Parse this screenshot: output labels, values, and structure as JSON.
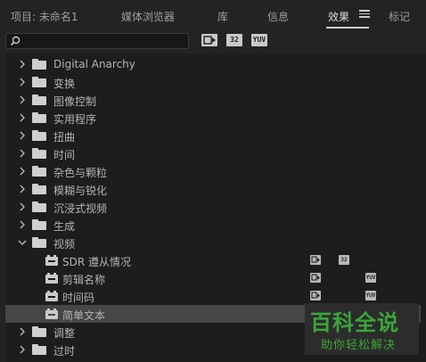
{
  "tabs": [
    {
      "label": "项目: 未命名1",
      "active": false
    },
    {
      "label": "媒体浏览器",
      "active": false
    },
    {
      "label": "库",
      "active": false
    },
    {
      "label": "信息",
      "active": false
    },
    {
      "label": "效果",
      "active": true
    },
    {
      "label": "标记",
      "active": false
    }
  ],
  "toolbar": {
    "search_value": "",
    "badges": [
      "accelerated",
      "32",
      "YUV"
    ]
  },
  "tree": [
    {
      "label": "Digital Anarchy",
      "type": "folder",
      "expanded": false
    },
    {
      "label": "变换",
      "type": "folder",
      "expanded": false
    },
    {
      "label": "图像控制",
      "type": "folder",
      "expanded": false
    },
    {
      "label": "实用程序",
      "type": "folder",
      "expanded": false
    },
    {
      "label": "扭曲",
      "type": "folder",
      "expanded": false
    },
    {
      "label": "时间",
      "type": "folder",
      "expanded": false
    },
    {
      "label": "杂色与颗粒",
      "type": "folder",
      "expanded": false
    },
    {
      "label": "模糊与锐化",
      "type": "folder",
      "expanded": false
    },
    {
      "label": "沉浸式视频",
      "type": "folder",
      "expanded": false
    },
    {
      "label": "生成",
      "type": "folder",
      "expanded": false
    },
    {
      "label": "视频",
      "type": "folder",
      "expanded": true
    },
    {
      "label": "SDR 遵从情况",
      "type": "effect",
      "badges": [
        "accelerated",
        "32"
      ]
    },
    {
      "label": "剪辑名称",
      "type": "effect",
      "badges": [
        "accelerated",
        "YUV"
      ]
    },
    {
      "label": "时间码",
      "type": "effect",
      "badges": [
        "accelerated",
        "YUV"
      ]
    },
    {
      "label": "简单文本",
      "type": "effect",
      "selected": true,
      "badges": []
    },
    {
      "label": "调整",
      "type": "folder",
      "expanded": false
    },
    {
      "label": "过时",
      "type": "folder",
      "expanded": false
    }
  ],
  "watermark": {
    "title": "百科全说",
    "subtitle": "助你轻松解决"
  },
  "colors": {
    "background": "#232323",
    "list_bg": "#1d1d1d",
    "selection": "#464646",
    "watermark": "#3aa53a"
  }
}
